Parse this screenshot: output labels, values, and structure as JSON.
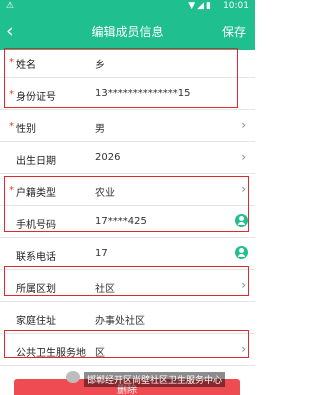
{
  "status_bar": {
    "time": "10:01",
    "icons": "▼◢▮"
  },
  "title_bar": {
    "back_icon": "chevron-left-icon",
    "title": "编辑成员信息",
    "save_label": "保存"
  },
  "fields": [
    {
      "label": "姓名",
      "value": "乡",
      "required": true,
      "chevron": false,
      "person_icon": false
    },
    {
      "label": "身份证号",
      "value": "13**************15",
      "required": true,
      "chevron": false,
      "person_icon": false
    },
    {
      "label": "性别",
      "value": "男",
      "required": true,
      "chevron": true,
      "person_icon": false
    },
    {
      "label": "出生日期",
      "value": "2026",
      "required": false,
      "chevron": true,
      "person_icon": false
    },
    {
      "label": "户籍类型",
      "value": "农业",
      "required": true,
      "chevron": true,
      "person_icon": false
    },
    {
      "label": "手机号码",
      "value": "17****425",
      "required": false,
      "chevron": false,
      "person_icon": true
    },
    {
      "label": "联系电话",
      "value": "17",
      "required": false,
      "chevron": false,
      "person_icon": true
    },
    {
      "label": "所属区划",
      "value": "社区",
      "required": false,
      "chevron": true,
      "person_icon": false
    },
    {
      "label": "家庭住址",
      "value": "办事处社区",
      "required": false,
      "chevron": false,
      "person_icon": false
    },
    {
      "label": "公共卫生服务地",
      "value": "区",
      "required": false,
      "chevron": true,
      "person_icon": false
    }
  ],
  "delete_label": "删除",
  "watermark": "邯郸经开区尚壁社区卫生服务中心",
  "colors": {
    "primary": "#1fbf8f",
    "highlight": "#e0282e",
    "danger": "#ef4b52"
  }
}
